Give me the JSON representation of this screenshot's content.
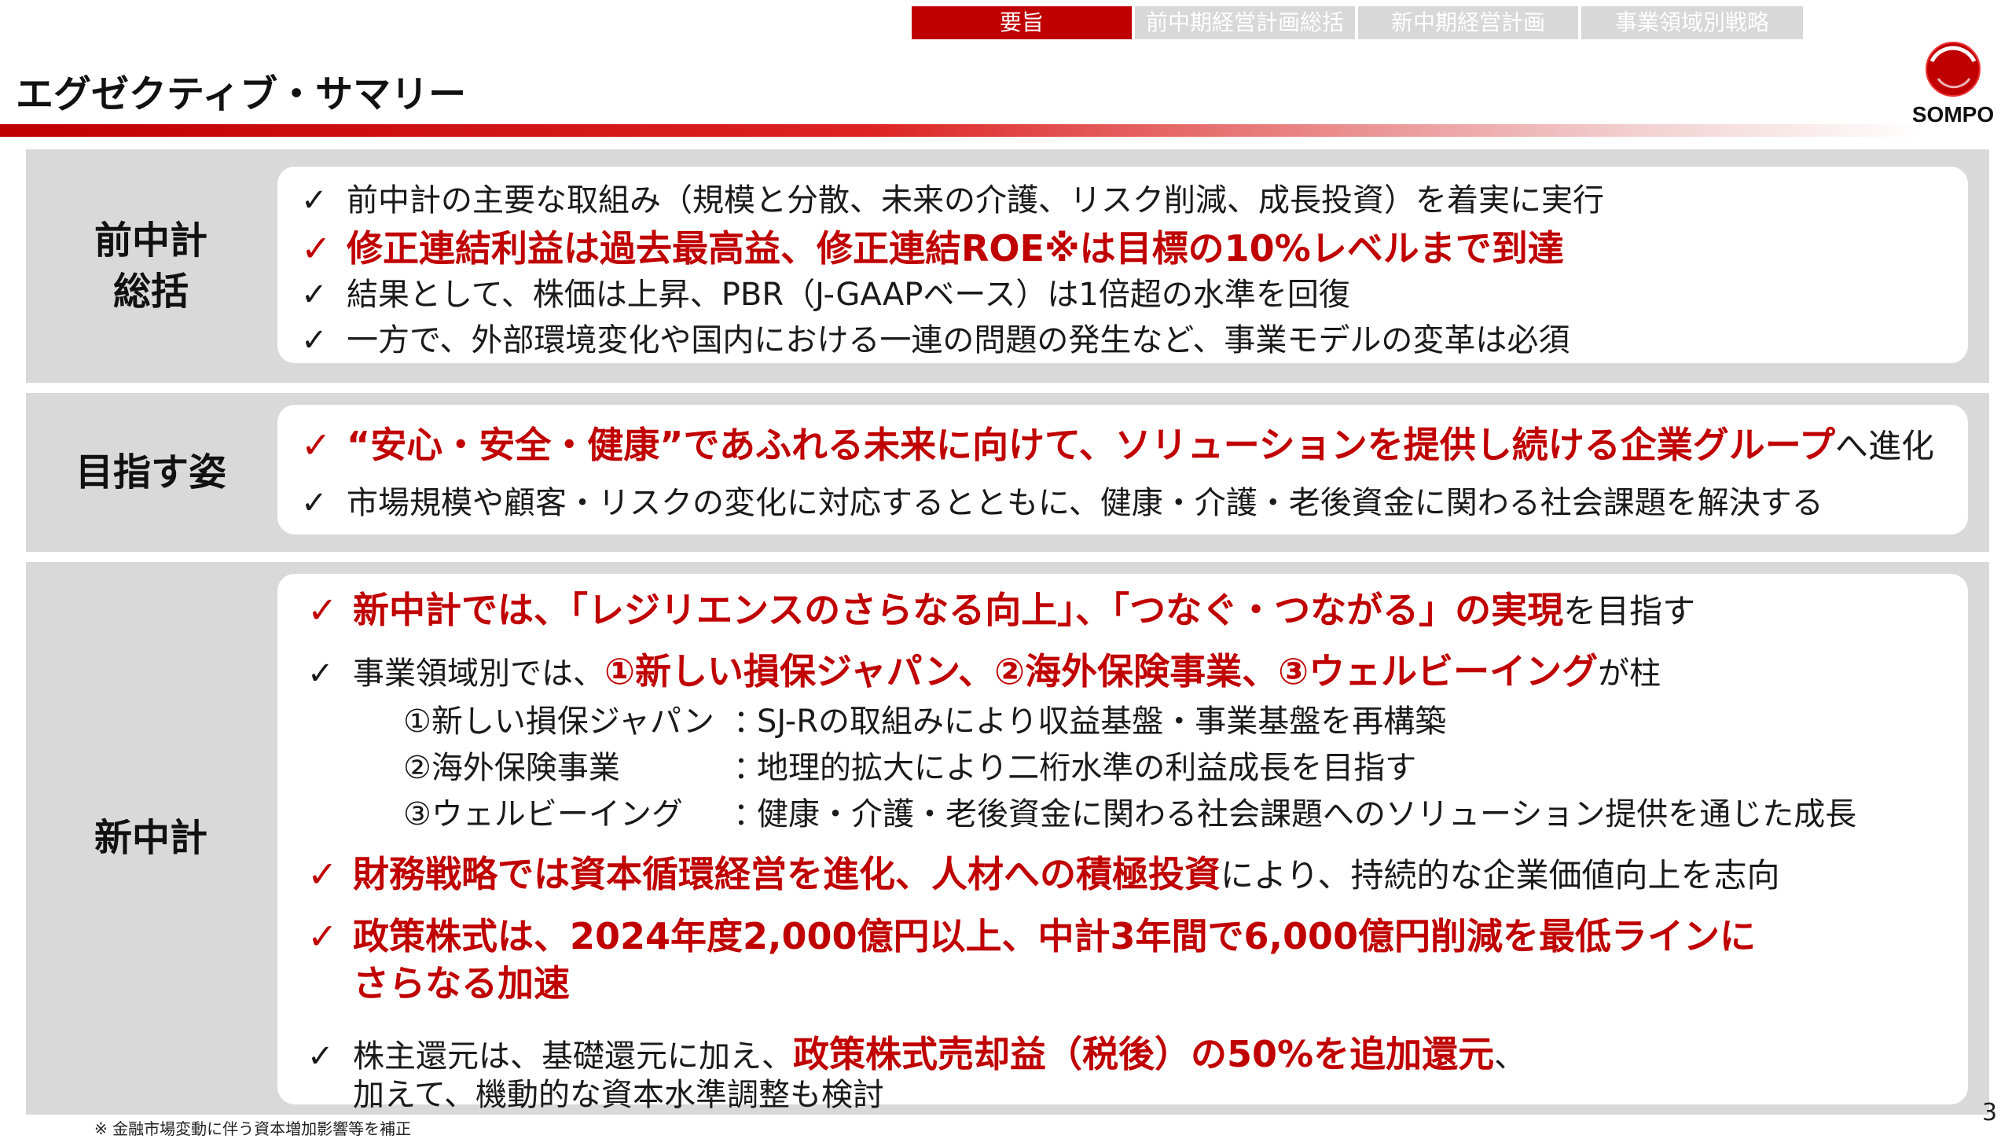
{
  "nav": {
    "tabs": [
      {
        "label": "要旨",
        "active": true
      },
      {
        "label": "前中期経営計画総括",
        "active": false
      },
      {
        "label": "新中期経営計画",
        "active": false
      },
      {
        "label": "事業領域別戦略",
        "active": false
      }
    ]
  },
  "header": {
    "title": "エグゼクティブ・サマリー",
    "logo_text": "SOMPO"
  },
  "colors": {
    "accent": "#c00000",
    "panel": "#d9d9d9"
  },
  "sections": {
    "prev": {
      "label_line1": "前中計",
      "label_line2": "総括",
      "items": [
        {
          "check": "✓",
          "text": "前中計の主要な取組み（規模と分散、未来の介護、リスク削減、成長投資）を着実に実行"
        },
        {
          "check": "✓",
          "text": "修正連結利益は過去最高益、修正連結ROE※は目標の10%レベルまで到達"
        },
        {
          "check": "✓",
          "text": "結果として、株価は上昇、PBR（J-GAAPベース）は1倍超の水準を回復"
        },
        {
          "check": "✓",
          "text": "一方で、外部環境変化や国内における一連の問題の発生など、事業モデルの変革は必須"
        }
      ]
    },
    "vision": {
      "label": "目指す姿",
      "item1_emph": "“安心・安全・健康”であふれる未来に向けて、ソリューションを提供し続ける企業グループ",
      "item1_rest": "へ進化",
      "item2": "市場規模や顧客・リスクの変化に対応するとともに、健康・介護・老後資金に関わる社会課題を解決する"
    },
    "new": {
      "label": "新中計",
      "item1_emph": "新中計では、「レジリエンスのさらなる向上」、「つなぐ・つながる」の実現",
      "item1_rest": "を目指す",
      "item2_pre": "事業領域別では、",
      "item2_emph": "①新しい損保ジャパン、②海外保険事業、③ウェルビーイング",
      "item2_rest": "が柱",
      "subs": [
        {
          "name": "①新しい損保ジャパン",
          "colon": "：",
          "desc": "SJ-Rの取組みにより収益基盤・事業基盤を再構築"
        },
        {
          "name": "②海外保険事業",
          "colon": "：",
          "desc": "地理的拡大により二桁水準の利益成長を目指す"
        },
        {
          "name": "③ウェルビーイング",
          "colon": "：",
          "desc": "健康・介護・老後資金に関わる社会課題へのソリューション提供を通じた成長"
        }
      ],
      "item3_emph": "財務戦略では資本循環経営を進化、人材への積極投資",
      "item3_rest": "により、持続的な企業価値向上を志向",
      "item4_line1": "政策株式は、2024年度2,000億円以上、中計3年間で6,000億円削減を最低ラインに",
      "item4_line2": "さらなる加速",
      "item5_pre": "株主還元は、基礎還元に加え、",
      "item5_emph": "政策株式売却益（税後）の50%を追加還元",
      "item5_rest": "、",
      "item5_line2": "加えて、機動的な資本水準調整も検討"
    }
  },
  "footnote": "※ 金融市場変動に伴う資本増加影響等を補正",
  "page_number": "3"
}
